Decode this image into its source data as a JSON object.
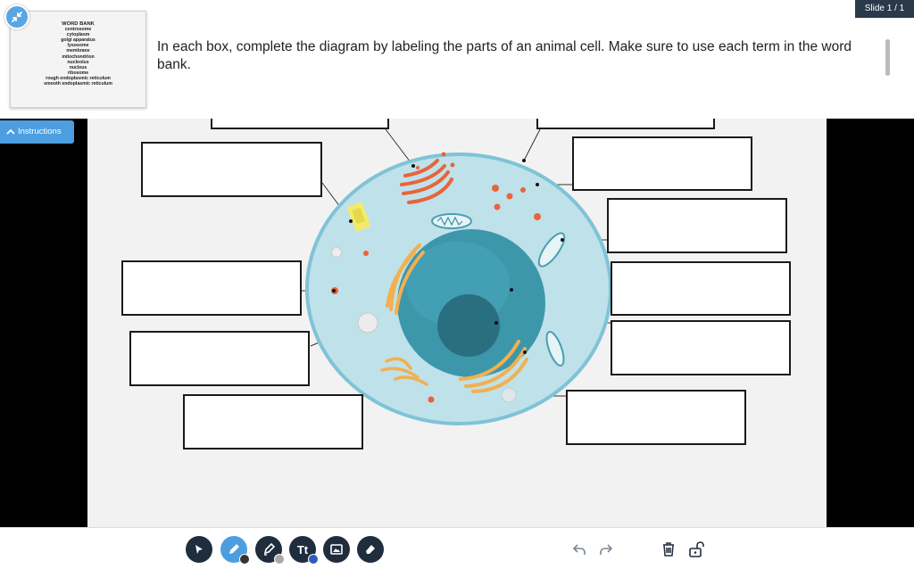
{
  "slide_indicator": "Slide 1 / 1",
  "word_bank": {
    "title": "WORD BANK",
    "terms": [
      "centrosome",
      "cytoplasm",
      "golgi apparatus",
      "lysosome",
      "membrane",
      "mitochondrion",
      "nucleolus",
      "nucleus",
      "ribosome",
      "rough endoplasmic reticulum",
      "smooth endoplasmic reticulum"
    ]
  },
  "instructions": {
    "text": "In each box, complete the diagram by labeling the parts of an animal cell. Make sure to use each term in the word bank.",
    "button_label": "Instructions"
  },
  "colors": {
    "accent": "#4c9ee0",
    "toolbar_dark": "#1f2d3d",
    "badge_bg": "#2b3a4a",
    "cell_fill": "#bfe1ea",
    "nucleus": "#3d97ab",
    "nucleolus": "#2a6f80",
    "golgi": "#e8643a",
    "er": "#f2b04f"
  },
  "toolbar": {
    "tools": [
      {
        "name": "select-tool",
        "icon": "cursor-icon"
      },
      {
        "name": "pen-tool",
        "icon": "pencil-icon",
        "active": true,
        "swatch": "#333333"
      },
      {
        "name": "highlighter-tool",
        "icon": "highlighter-icon",
        "swatch": "#aaaaaa"
      },
      {
        "name": "text-tool",
        "icon": "text-icon",
        "glyph": "Tt",
        "swatch": "#2c5fb8"
      },
      {
        "name": "image-tool",
        "icon": "image-icon"
      },
      {
        "name": "eraser-tool",
        "icon": "eraser-icon"
      }
    ],
    "actions": [
      "undo-icon",
      "redo-icon",
      "trash-icon",
      "unlock-icon"
    ]
  }
}
